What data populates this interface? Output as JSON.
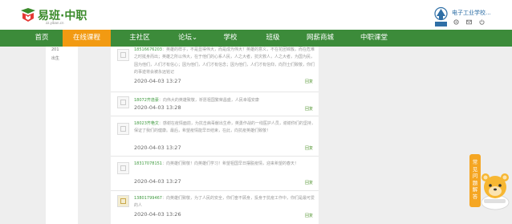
{
  "header": {
    "logo_text": "易班·中职",
    "logo_sub": "zz.yiban.cn",
    "user_name": "电子工业学校...",
    "icons": [
      "settings-icon",
      "mail-icon",
      "power-icon"
    ]
  },
  "nav": {
    "items": [
      {
        "label": "首页"
      },
      {
        "label": "在线课程",
        "active": true
      },
      {
        "label": "主社区"
      },
      {
        "label": "论坛⌄"
      },
      {
        "label": "学校"
      },
      {
        "label": "班级"
      },
      {
        "label": "网薪商城"
      },
      {
        "label": "中职课堂"
      }
    ]
  },
  "sidebar": {
    "items": [
      {
        "label": "201"
      },
      {
        "label": "出生"
      }
    ]
  },
  "comments": [
    {
      "user": "18516676203",
      "text": "：英雄的样子，不是显得伟大，而是成为伟大！英雄的意义，不在花团锦簇，而在危难之时挺身而出；英雄之所以伟大，在于他们的心系人民，人之大者，抗灾救人，人之大者，为国为民，因为他们，人们才有信心；因为他们，人们才有信念；因为他们，人们才有信仰，向烈士们致敬，你们的事迹将会被永远铭记",
      "time": "2020-04-03 13:27",
      "reply": "回复"
    },
    {
      "user": "18072齐逸豪",
      "text": "：向伟大的英雄致敬，祈愿祖国繁荣昌盛，人民幸福安康",
      "time": "2020-04-03 13:28",
      "reply": "回复"
    },
    {
      "user": "18023齐艳文",
      "text": "：感谢在疫情面前，为抗击病毒献出生命，英勇作战的一线医护人员，谢谢你们的坚持，保证了我们的健康。最后，希望疫情能早日结束，在此，向抗疫英雄们致敬！",
      "time": "2020-04-03 13:27",
      "reply": "回复"
    },
    {
      "user": "18317078151",
      "text": "：向英雄们致敬！向英雄们学习！希望祖国早日摆脱疫情，迎来希望的春天！",
      "time": "2020-04-03 13:27",
      "reply": "回复"
    },
    {
      "user": "13801799467",
      "text": "：向英雄们致敬，为了人民的安全，你们奋不顾身，投身于抗疫工作中，你们是最可爱的人",
      "time": "2020-04-03 13:26",
      "reply": "回复"
    }
  ],
  "helper": {
    "label": "常见问题解答"
  },
  "colors": {
    "nav_bg": "#3c8b3a",
    "nav_active": "#f29a12",
    "username_green": "#3f9a3f",
    "helper_orange": "#f5a623"
  }
}
